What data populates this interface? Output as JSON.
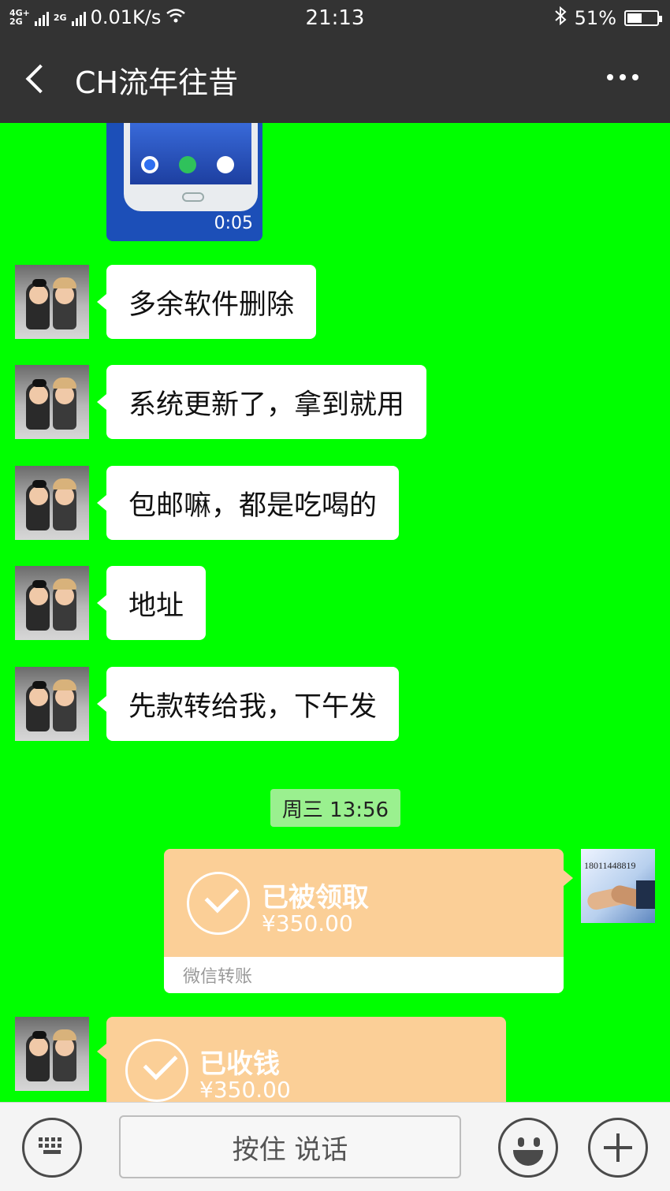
{
  "status_bar": {
    "network_tag": "4G+",
    "network_tag2": "2G",
    "network_tag3": "2G",
    "speed": "0.01K/s",
    "time": "21:13",
    "bluetooth_icon": "bluetooth-icon",
    "battery_percent": "51%",
    "battery_level": 0.51
  },
  "header": {
    "back_icon": "back-chevron-icon",
    "title": "CH流年往昔",
    "more_icon": "more-dots-icon"
  },
  "video_message": {
    "duration": "0:05"
  },
  "messages": [
    {
      "text": "多余软件删除"
    },
    {
      "text": "系统更新了，拿到就用"
    },
    {
      "text": "包邮嘛，都是吃喝的"
    },
    {
      "text": "地址"
    },
    {
      "text": "先款转给我，下午发"
    }
  ],
  "timestamp": "周三 13:56",
  "transfer_sent": {
    "status": "已被领取",
    "amount": "¥350.00",
    "footer": "微信转账"
  },
  "self_avatar_text": "18011448819",
  "transfer_received": {
    "status": "已收钱",
    "amount": "¥350.00"
  },
  "input_bar": {
    "keyboard_icon": "keyboard-icon",
    "hold_to_talk": "按住 说话",
    "emoji_icon": "emoji-icon",
    "plus_icon": "plus-icon"
  },
  "colors": {
    "chat_background": "#00ff00",
    "header_background": "#333333",
    "transfer_orange": "#fbcf97",
    "timestamp_bg": "#9af08f"
  }
}
